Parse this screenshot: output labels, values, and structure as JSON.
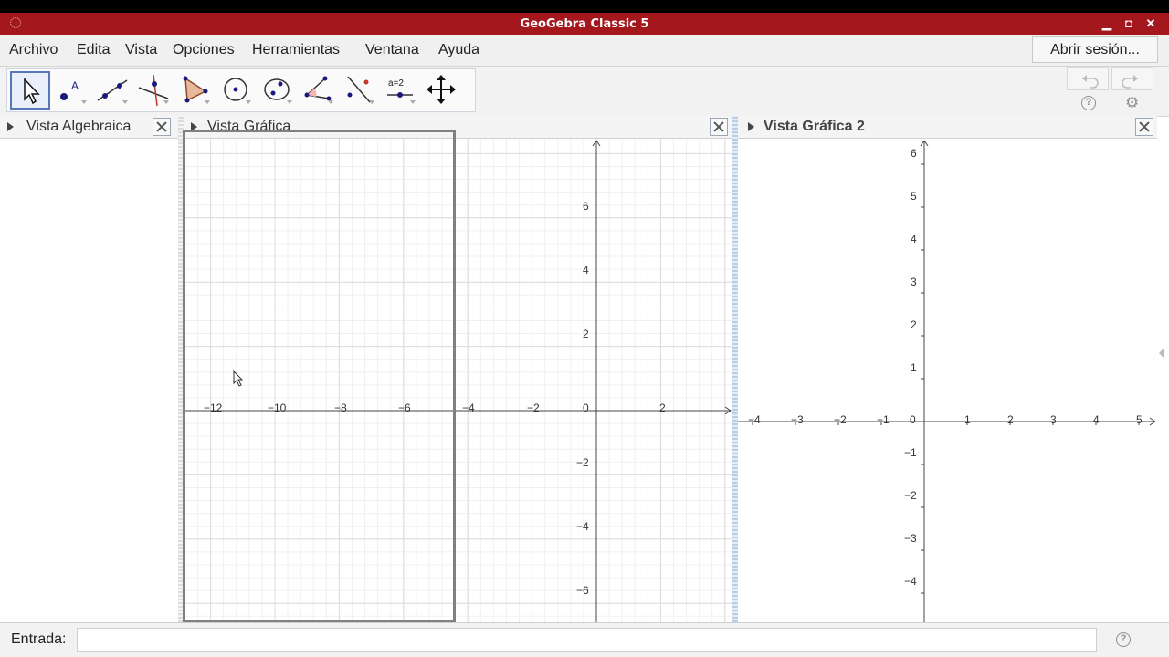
{
  "window": {
    "title": "GeoGebra Classic 5"
  },
  "menu": {
    "items": [
      "Archivo",
      "Edita",
      "Vista",
      "Opciones",
      "Herramientas",
      "Ventana",
      "Ayuda"
    ],
    "login_label": "Abrir sesión..."
  },
  "toolbar": {
    "tools": [
      "move-tool-icon",
      "point-tool-icon",
      "line-tool-icon",
      "perpendicular-tool-icon",
      "polygon-tool-icon",
      "circle-tool-icon",
      "conic-tool-icon",
      "angle-tool-icon",
      "reflect-tool-icon",
      "slider-tool-icon",
      "move-view-tool-icon"
    ],
    "slider_icon_text": "a=2",
    "selected_tool": "move-tool-icon"
  },
  "panels": {
    "algebra": {
      "title": "Vista Algebraica"
    },
    "graphics1": {
      "title": "Vista Gráfica",
      "x_ticks": [
        "−12",
        "−10",
        "−8",
        "−6",
        "−4",
        "−2",
        "0",
        "2"
      ],
      "y_ticks": [
        "6",
        "4",
        "2",
        "−2",
        "−4",
        "−6"
      ]
    },
    "graphics2": {
      "title": "Vista Gráfica 2",
      "x_ticks": [
        "−4",
        "−3",
        "−2",
        "−1",
        "0",
        "1",
        "2",
        "3",
        "4",
        "5"
      ],
      "y_ticks": [
        "6",
        "5",
        "4",
        "3",
        "2",
        "1",
        "−1",
        "−2",
        "−3",
        "−4"
      ]
    }
  },
  "input": {
    "label": "Entrada:",
    "value": "",
    "placeholder": ""
  },
  "colors": {
    "titlebar": "#a3171d",
    "selection": "#808080"
  }
}
